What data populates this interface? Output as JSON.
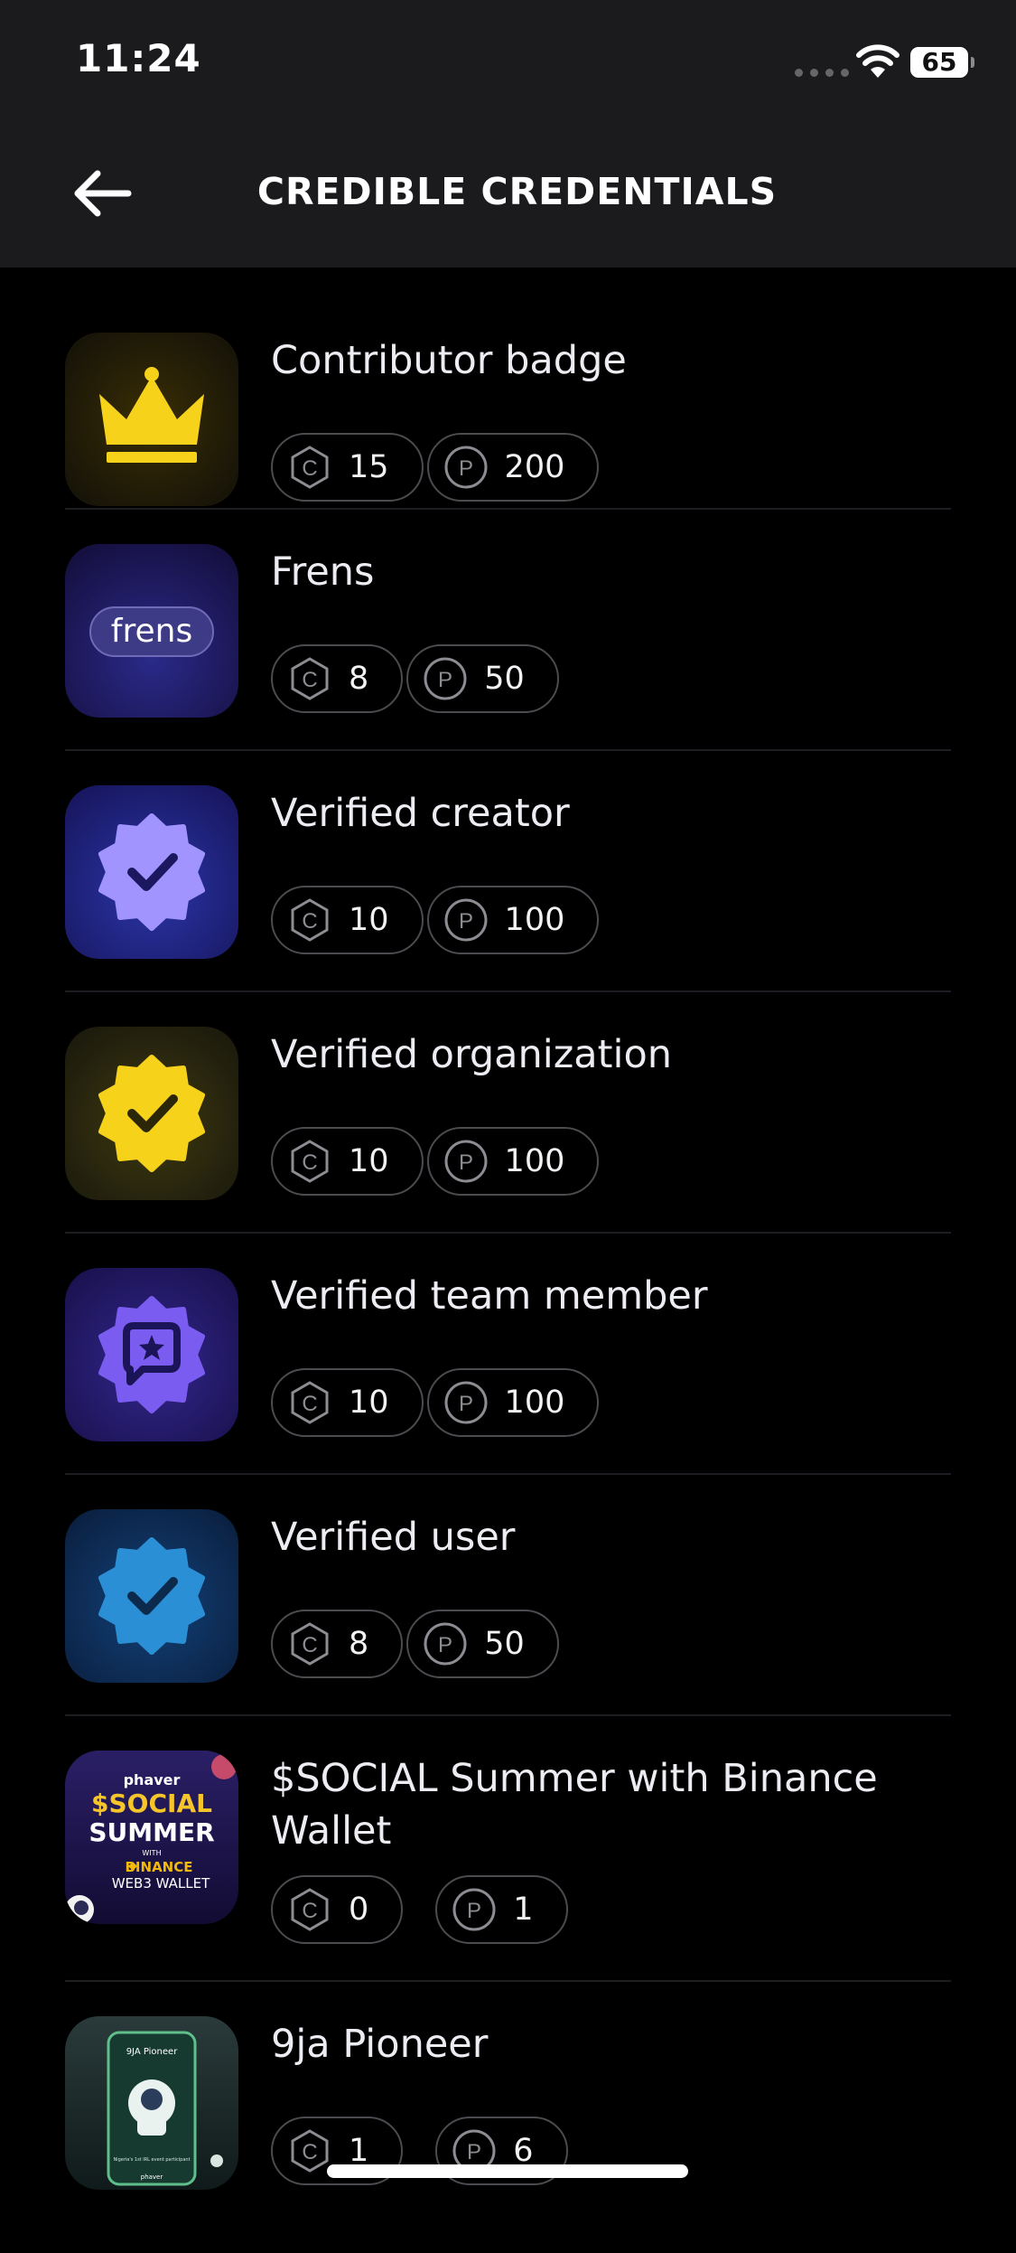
{
  "status_bar": {
    "time": "11:24",
    "battery": "65"
  },
  "header": {
    "title": "CREDIBLE CREDENTIALS"
  },
  "icons": {
    "back": "arrow-left-icon",
    "credibility": "hexagon-c-icon",
    "points": "circle-p-icon"
  },
  "credentials": [
    {
      "name": "Contributor badge",
      "c": "15",
      "p": "200",
      "icon": "crown-icon"
    },
    {
      "name": "Frens",
      "c": "8",
      "p": "50",
      "icon": "frens-logo",
      "logo_text": "frens"
    },
    {
      "name": "Verified creator",
      "c": "10",
      "p": "100",
      "icon": "verified-badge-icon"
    },
    {
      "name": "Verified organization",
      "c": "10",
      "p": "100",
      "icon": "verified-badge-icon"
    },
    {
      "name": "Verified team member",
      "c": "10",
      "p": "100",
      "icon": "team-badge-icon"
    },
    {
      "name": "Verified user",
      "c": "8",
      "p": "50",
      "icon": "verified-badge-icon"
    },
    {
      "name": "$SOCIAL Summer with Binance Wallet",
      "c": "0",
      "p": "1",
      "icon": "social-summer-image",
      "art": {
        "brand": "phaver",
        "line1": "$SOCIAL",
        "line2": "SUMMER",
        "with": "WITH",
        "binance": "BINANCE",
        "wallet": "WEB3 WALLET"
      }
    },
    {
      "name": "9ja Pioneer",
      "c": "1",
      "p": "6",
      "icon": "9ja-pioneer-image",
      "art": {
        "title": "9JA Pioneer",
        "caption": "Nigeria's 1st IRL event participant",
        "brand": "phaver"
      }
    }
  ],
  "colors": {
    "header_bg": "#1b1b1d",
    "page_bg": "#000000",
    "gold": "#f6d21a",
    "lavender": "#a294ff",
    "purple": "#7b5cf0",
    "blue": "#2b8fd6"
  }
}
